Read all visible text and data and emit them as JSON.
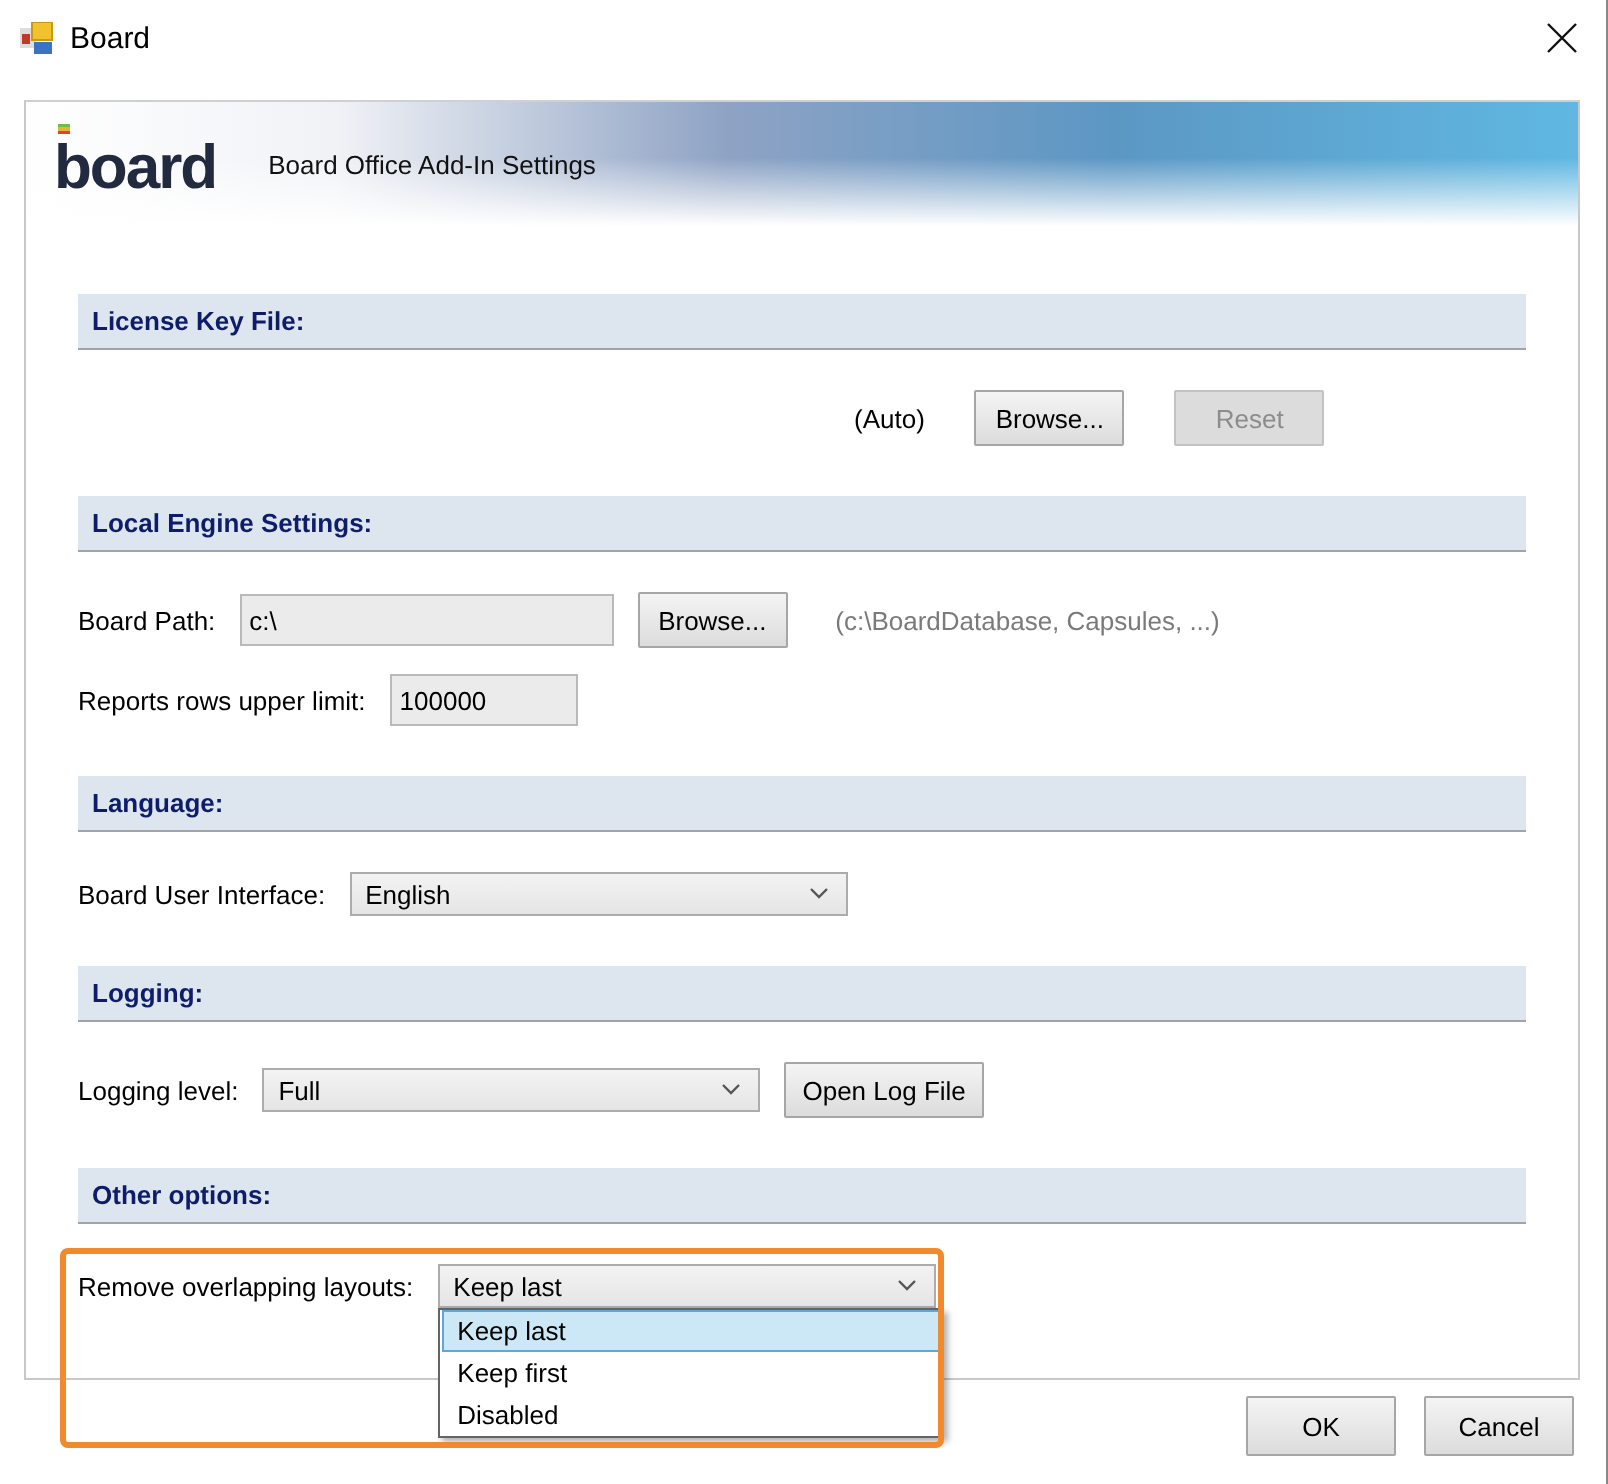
{
  "window": {
    "title": "Board"
  },
  "header": {
    "logo": "board",
    "title": "Board Office Add-In Settings"
  },
  "sections": [
    {
      "title": "License Key File:",
      "lines": [
        {
          "controls": [
            {
              "kind": "text",
              "text": "(Auto)"
            },
            {
              "kind": "button",
              "label": "Browse...",
              "disabled": false
            },
            {
              "kind": "button",
              "label": "Reset",
              "disabled": true
            }
          ]
        }
      ]
    },
    {
      "title": "Local Engine Settings:",
      "lines": [
        {
          "controls": [
            {
              "kind": "label",
              "text": "Board Path:"
            },
            {
              "kind": "field",
              "value": "c:\\"
            },
            {
              "kind": "button",
              "label": "Browse...",
              "disabled": false
            },
            {
              "kind": "hint",
              "text": "(c:\\BoardDatabase, Capsules, ...)"
            }
          ]
        },
        {
          "controls": [
            {
              "kind": "label",
              "text": "Reports rows upper limit:"
            },
            {
              "kind": "field",
              "value": "100000"
            }
          ]
        }
      ]
    },
    {
      "title": "Language:",
      "lines": [
        {
          "controls": [
            {
              "kind": "label",
              "text": "Board User Interface:"
            },
            {
              "kind": "combo",
              "value": "English",
              "expanded": false
            }
          ]
        }
      ]
    },
    {
      "title": "Logging:",
      "lines": [
        {
          "controls": [
            {
              "kind": "label",
              "text": "Logging level:"
            },
            {
              "kind": "combo",
              "value": "Full",
              "expanded": false
            },
            {
              "kind": "button",
              "label": "Open Log File",
              "disabled": false
            }
          ]
        }
      ]
    },
    {
      "title": "Other options:",
      "lines": [
        {
          "controls": [
            {
              "kind": "label",
              "text": "Remove overlapping layouts:"
            },
            {
              "kind": "combo",
              "value": "Keep last",
              "expanded": true,
              "options": [
                {
                  "label": "Keep last",
                  "selected": true
                },
                {
                  "label": "Keep first",
                  "selected": false
                },
                {
                  "label": "Disabled",
                  "selected": false
                }
              ]
            }
          ]
        }
      ]
    }
  ],
  "buttons": [
    {
      "label": "OK"
    },
    {
      "label": "Cancel"
    }
  ]
}
